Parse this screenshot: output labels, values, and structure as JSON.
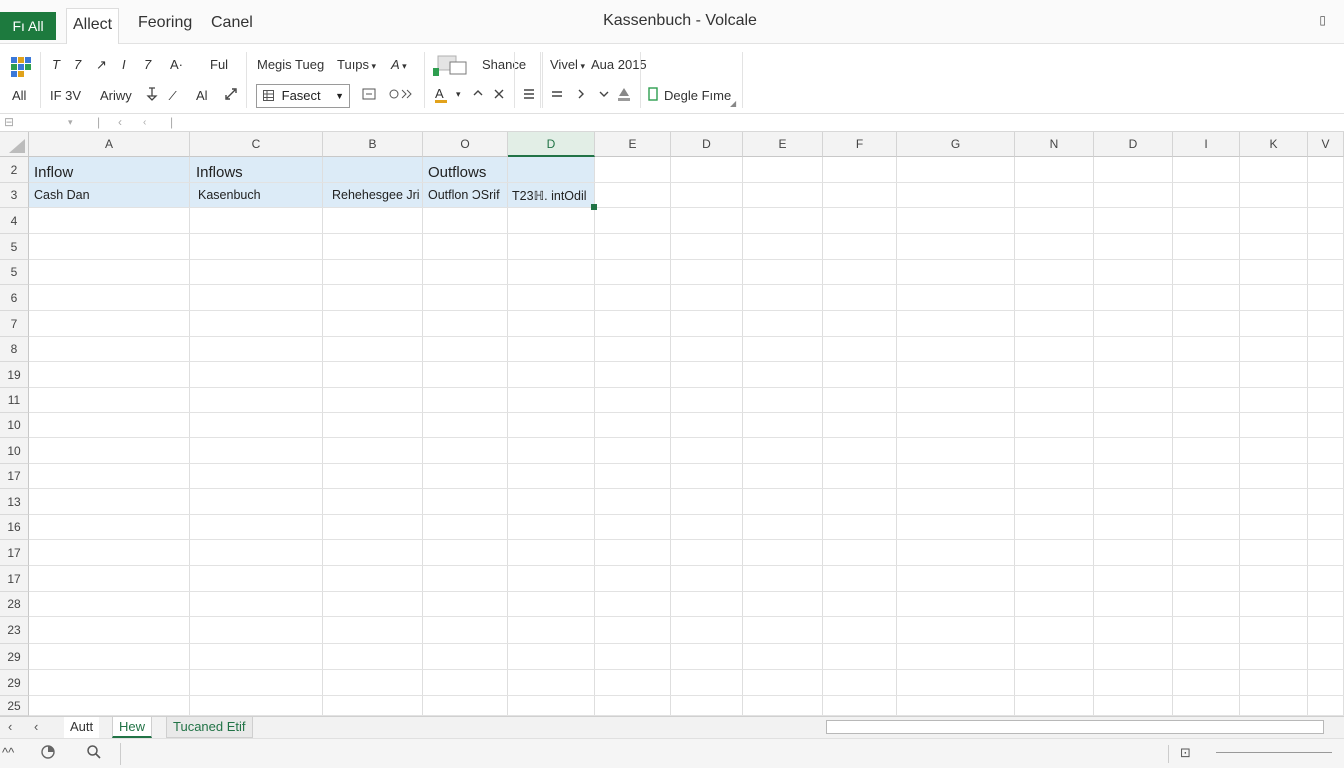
{
  "titlebar": {
    "file_label": "Fı All",
    "tabs": [
      "Allect",
      "Feoring",
      "Canel"
    ],
    "window_title": "Kassenbuch - Volcale",
    "window_button": "▯"
  },
  "ribbon": {
    "row1": {
      "format_glyphs": [
        "T",
        "7",
        "↗",
        "I",
        "7",
        "A·"
      ],
      "full_label": "Ful",
      "merge_label": "Megis Tueg",
      "tumps_label": "Tuıps",
      "a_label": "A",
      "share_label": "Shance",
      "vivel_label": "Vivel",
      "aura_label": "Aua 2015"
    },
    "row2": {
      "all_label": "All",
      "if_label": "IF 3V",
      "arwy_label": "Ariwy",
      "paste_glyph": "⁄",
      "al_label": "Al",
      "font_name": "Fasect",
      "deglerime_label": "Degle Fıme"
    }
  },
  "columns": [
    {
      "label": "A",
      "sel": false
    },
    {
      "label": "C",
      "sel": false
    },
    {
      "label": "B",
      "sel": false
    },
    {
      "label": "O",
      "sel": false
    },
    {
      "label": "D",
      "sel": true
    },
    {
      "label": "E",
      "sel": false
    },
    {
      "label": "D",
      "sel": false
    },
    {
      "label": "E",
      "sel": false
    },
    {
      "label": "F",
      "sel": false
    },
    {
      "label": "G",
      "sel": false
    },
    {
      "label": "N",
      "sel": false
    },
    {
      "label": "D",
      "sel": false
    },
    {
      "label": "I",
      "sel": false
    },
    {
      "label": "K",
      "sel": false
    },
    {
      "label": "V",
      "sel": false
    }
  ],
  "rows": [
    "2",
    "3",
    "4",
    "5",
    "5",
    "6",
    "7",
    "8",
    "19",
    "11",
    "10",
    "10",
    "17",
    "13",
    "16",
    "17",
    "17",
    "28",
    "23",
    "29",
    "29",
    "25"
  ],
  "cells": {
    "inflow": "Inflow",
    "inflows": "Inflows",
    "outflows": "Outflows",
    "cash_dan": "Cash Dan",
    "kasenbuch": "Kasenbuch",
    "rehesgee": "Rehehesgee Jri",
    "outflon": "Outflon ϽSrif",
    "intodil": "T23ℍ. intOdil"
  },
  "sheets": [
    "Autt",
    "Hew",
    "Tucaned Etif"
  ],
  "statusbar": {
    "left_glyph": "^^",
    "right_glyph": "⊡"
  }
}
